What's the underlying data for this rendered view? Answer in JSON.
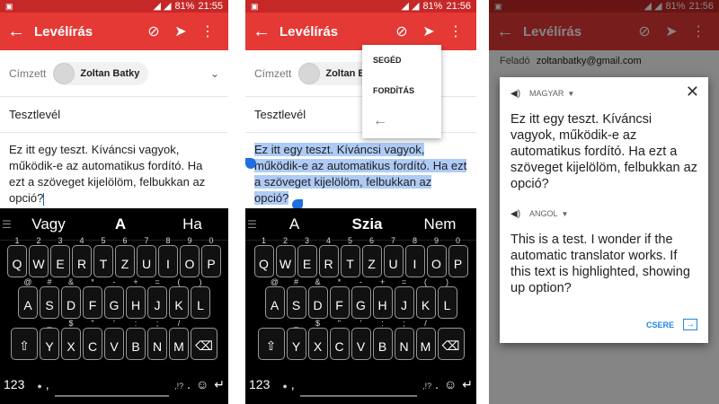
{
  "status": {
    "battery": "81%",
    "signal": "◢ ◢",
    "times": [
      "21:55",
      "21:56",
      "21:56"
    ]
  },
  "app": {
    "title": "Levélírás"
  },
  "compose": {
    "to_label": "Címzett",
    "from_label": "Feladó",
    "recipient": "Zoltan Batky",
    "from_email": "zoltanbatky@gmail.com",
    "subject": "Tesztlevél",
    "body": "Ez itt egy teszt. Kíváncsi vagyok, működik-e az automatikus fordító. Ha ezt a szöveget kijelölöm, felbukkan az opció?"
  },
  "keyboard1": {
    "suggestions": [
      "Vagy",
      "A",
      "Ha"
    ]
  },
  "keyboard2": {
    "suggestions": [
      "A",
      "Szia",
      "Nem"
    ]
  },
  "keyboard": {
    "row1": [
      [
        "1",
        "Q"
      ],
      [
        "2",
        "W"
      ],
      [
        "3",
        "E"
      ],
      [
        "4",
        "R"
      ],
      [
        "5",
        "T"
      ],
      [
        "6",
        "Z"
      ],
      [
        "7",
        "U"
      ],
      [
        "8",
        "I"
      ],
      [
        "9",
        "O"
      ],
      [
        "0",
        "P"
      ]
    ],
    "row2": [
      [
        "@",
        "A"
      ],
      [
        "#",
        "S"
      ],
      [
        "&",
        "D"
      ],
      [
        "*",
        "F"
      ],
      [
        "-",
        "G"
      ],
      [
        "+",
        "H"
      ],
      [
        "=",
        "J"
      ],
      [
        "(",
        "K"
      ],
      [
        ")",
        "L"
      ]
    ],
    "row3": [
      [
        "_",
        "Y"
      ],
      [
        "$",
        "X"
      ],
      [
        "\"",
        "C"
      ],
      [
        "'",
        "V"
      ],
      [
        ":",
        "B"
      ],
      [
        ";",
        "N"
      ],
      [
        "/",
        "M"
      ]
    ],
    "numbers_label": "123",
    "comma": ",",
    "period": ".",
    "punct_hint": ",!?",
    "shift_icon": "⇧",
    "backspace_icon": "⌫",
    "enter_icon": "↵",
    "emoji_icon": "☺",
    "mic_icon": "●"
  },
  "menu": {
    "items": [
      "SEGÉD",
      "FORDÍTÁS"
    ],
    "back": "←"
  },
  "translate": {
    "source_lang": "MAGYAR",
    "target_lang": "ANGOL",
    "source_text": "Ez itt egy teszt. Kíváncsi vagyok, működik-e az automatikus fordító. Ha ezt a szöveget kijelölöm, felbukkan az opció?",
    "target_text": "This is a test. I wonder if the automatic translator works. If this text is highlighted, showing up option?",
    "swap_label": "CSERE"
  }
}
